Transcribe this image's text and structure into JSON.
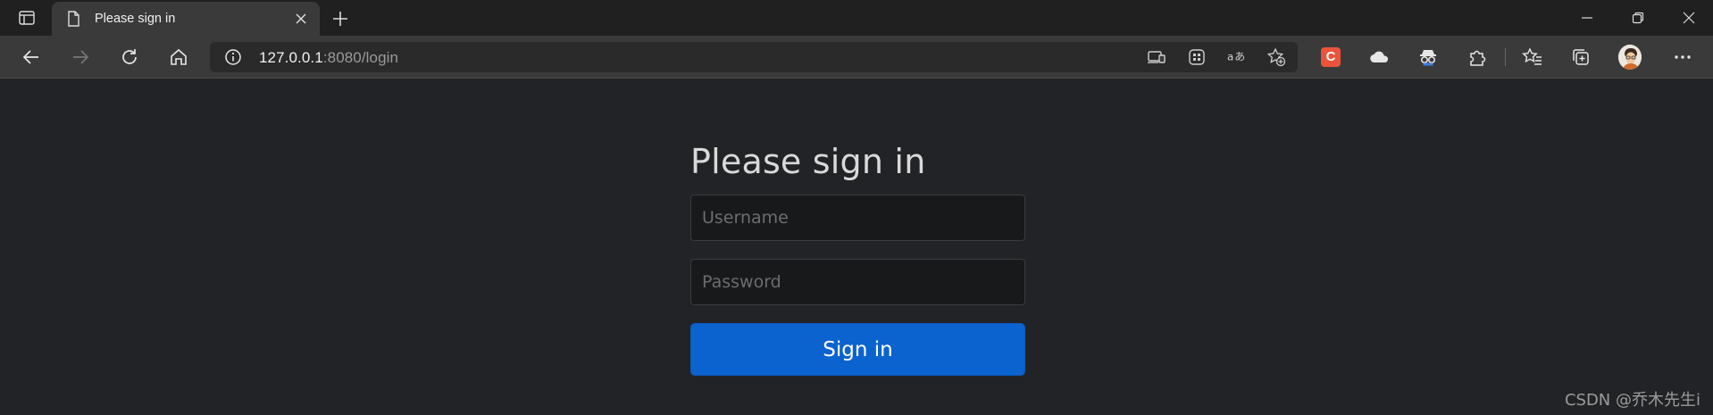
{
  "browser": {
    "tab": {
      "title": "Please sign in"
    },
    "address": {
      "host": "127.0.0.1",
      "path": ":8080/login"
    },
    "extensions": {
      "csdn_letter": "C"
    }
  },
  "page": {
    "heading": "Please sign in",
    "username": {
      "placeholder": "Username",
      "value": ""
    },
    "password": {
      "placeholder": "Password",
      "value": ""
    },
    "submit_label": "Sign in"
  },
  "watermark": "CSDN @乔木先生i",
  "colors": {
    "page_bg": "#222326",
    "button_bg": "#0b63cf",
    "input_bg": "#18191b",
    "csdn_ext": "#e9543b"
  }
}
